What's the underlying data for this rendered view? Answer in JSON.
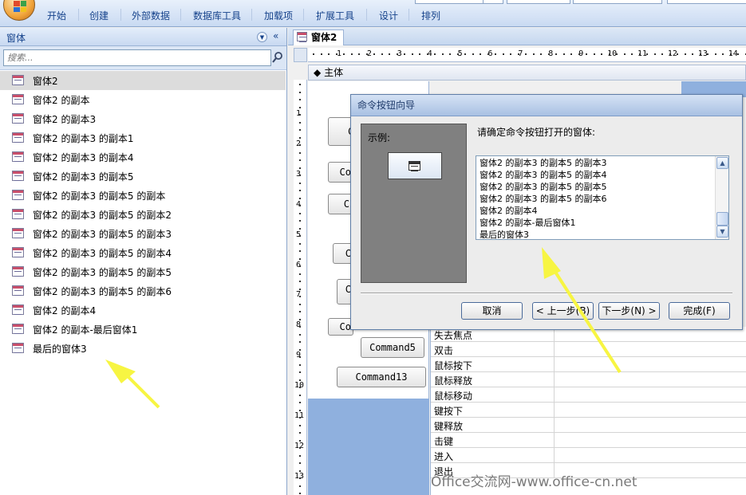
{
  "ribbon": {
    "tabs": [
      "开始",
      "创建",
      "外部数据",
      "数据库工具",
      "加载项",
      "扩展工具",
      "设计",
      "排列"
    ]
  },
  "nav": {
    "title": "窗体",
    "search_placeholder": "搜索...",
    "items": [
      {
        "label": "窗体2",
        "selected": true
      },
      {
        "label": "窗体2 的副本"
      },
      {
        "label": "窗体2 的副本3"
      },
      {
        "label": "窗体2 的副本3 的副本1"
      },
      {
        "label": "窗体2 的副本3 的副本4"
      },
      {
        "label": "窗体2 的副本3 的副本5"
      },
      {
        "label": "窗体2 的副本3 的副本5 的副本"
      },
      {
        "label": "窗体2 的副本3 的副本5 的副本2"
      },
      {
        "label": "窗体2 的副本3 的副本5 的副本3"
      },
      {
        "label": "窗体2 的副本3 的副本5 的副本4"
      },
      {
        "label": "窗体2 的副本3 的副本5 的副本5"
      },
      {
        "label": "窗体2 的副本3 的副本5 的副本6"
      },
      {
        "label": "窗体2 的副本4"
      },
      {
        "label": "窗体2 的副本-最后窗体1"
      },
      {
        "label": "最后的窗体3"
      }
    ]
  },
  "design": {
    "doc_tab": "窗体2",
    "section_label": "主体",
    "ruler_h": [
      "1",
      "2",
      "3",
      "4",
      "5",
      "6",
      "7",
      "8",
      "9",
      "10",
      "11",
      "12",
      "13",
      "14"
    ],
    "ruler_v": [
      "1",
      "2",
      "3",
      "4",
      "5",
      "6",
      "7",
      "8",
      "9",
      "10",
      "11",
      "12",
      "13"
    ],
    "buttons": [
      {
        "label": "C"
      },
      {
        "label": "Co"
      },
      {
        "label": "C"
      },
      {
        "label": "C"
      },
      {
        "label": "C"
      },
      {
        "label": "C"
      },
      {
        "label": "Co"
      },
      {
        "label": "Command5"
      },
      {
        "label": "Command13"
      }
    ]
  },
  "props": {
    "rows": [
      "失去焦点",
      "双击",
      "鼠标按下",
      "鼠标释放",
      "鼠标移动",
      "键按下",
      "键释放",
      "击键",
      "进入",
      "退出"
    ]
  },
  "wizard": {
    "title": "命令按钮向导",
    "sample_label": "示例:",
    "prompt": "请确定命令按钮打开的窗体:",
    "list_items": [
      "窗体2 的副本3 的副本5 的副本3",
      "窗体2 的副本3 的副本5 的副本4",
      "窗体2 的副本3 的副本5 的副本5",
      "窗体2 的副本3 的副本5 的副本6",
      "窗体2 的副本4",
      "窗体2 的副本-最后窗体1",
      "最后的窗体3"
    ],
    "buttons": {
      "cancel": "取消",
      "back": "< 上一步(B)",
      "next": "下一步(N) >",
      "finish": "完成(F)"
    }
  },
  "watermark": "Office交流网-www.office-cn.net",
  "colors": {
    "ribbon_text": "#15428b",
    "arrow": "#f7f542",
    "form_icon_bar": "#c94f6b",
    "canvas_blue": "#8fb0de"
  }
}
